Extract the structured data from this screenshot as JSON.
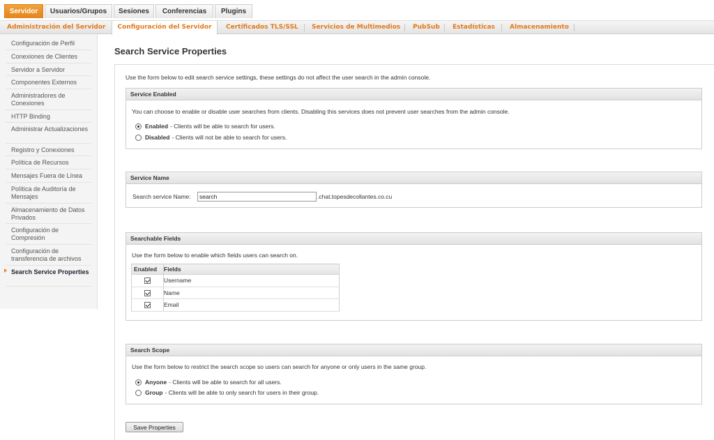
{
  "top_tabs": [
    {
      "label": "Servidor",
      "active": true
    },
    {
      "label": "Usuarios/Grupos",
      "active": false
    },
    {
      "label": "Sesiones",
      "active": false
    },
    {
      "label": "Conferencias",
      "active": false
    },
    {
      "label": "Plugins",
      "active": false
    }
  ],
  "sub_nav": [
    {
      "label": "Administración del Servidor",
      "active": false
    },
    {
      "label": "Configuración del Servidor",
      "active": true
    },
    {
      "label": "Certificados TLS/SSL",
      "active": false
    },
    {
      "label": "Servicios de Multimedios",
      "active": false
    },
    {
      "label": "PubSub",
      "active": false
    },
    {
      "label": "Estadísticas",
      "active": false
    },
    {
      "label": "Almacenamiento",
      "active": false
    }
  ],
  "sidebar": {
    "items": [
      {
        "label": "Configuración de Perfil"
      },
      {
        "label": "Conexiones de Clientes"
      },
      {
        "label": "Servidor a Servidor"
      },
      {
        "label": "Componentes Externos"
      },
      {
        "label": "Administradores de Conexiones"
      },
      {
        "label": "HTTP Binding"
      },
      {
        "label": "Administrar Actualizaciones"
      },
      {
        "label": "Registro y Conexiones"
      },
      {
        "label": "Política de Recursos"
      },
      {
        "label": "Mensajes Fuera de Línea"
      },
      {
        "label": "Política de Auditoría de Mensajes"
      },
      {
        "label": "Almacenamiento de Datos Privados"
      },
      {
        "label": "Configuración de Compresión"
      },
      {
        "label": "Configuración de transferencia de archivos"
      },
      {
        "label": "Search Service Properties",
        "active": true
      }
    ]
  },
  "main": {
    "title": "Search Service Properties",
    "intro": "Use the form below to edit search service settings, these settings do not affect the user search in the admin console.",
    "service_enabled": {
      "header": "Service Enabled",
      "description": "You can choose to enable or disable user searches from clients. Disabling this services does not prevent user searches from the admin console.",
      "options": [
        {
          "bold": "Enabled",
          "rest": " - Clients will be able to search for users.",
          "checked": true
        },
        {
          "bold": "Disabled",
          "rest": " - Clients will not be able to search for users.",
          "checked": false
        }
      ]
    },
    "service_name": {
      "header": "Service Name",
      "label": "Search service Name:",
      "value": "search",
      "domain": ".chat.topesdecollantes.co.cu"
    },
    "searchable_fields": {
      "header": "Searchable Fields",
      "description": "Use the form below to enable which fields users can search on.",
      "columns": [
        "Enabled",
        "Fields"
      ],
      "rows": [
        {
          "field": "Username",
          "enabled": true
        },
        {
          "field": "Name",
          "enabled": true
        },
        {
          "field": "Email",
          "enabled": true
        }
      ]
    },
    "search_scope": {
      "header": "Search Scope",
      "description": "Use the form below to restrict the search scope so users can search for anyone or only users in the same group.",
      "options": [
        {
          "bold": "Anyone",
          "rest": " - Clients will be able to search for all users.",
          "checked": true
        },
        {
          "bold": "Group",
          "rest": " - Clients will be able to only search for users in their group.",
          "checked": false
        }
      ]
    },
    "save_label": "Save Properties"
  },
  "colors": {
    "accent": "#e5841c",
    "link": "#e07a1b"
  }
}
